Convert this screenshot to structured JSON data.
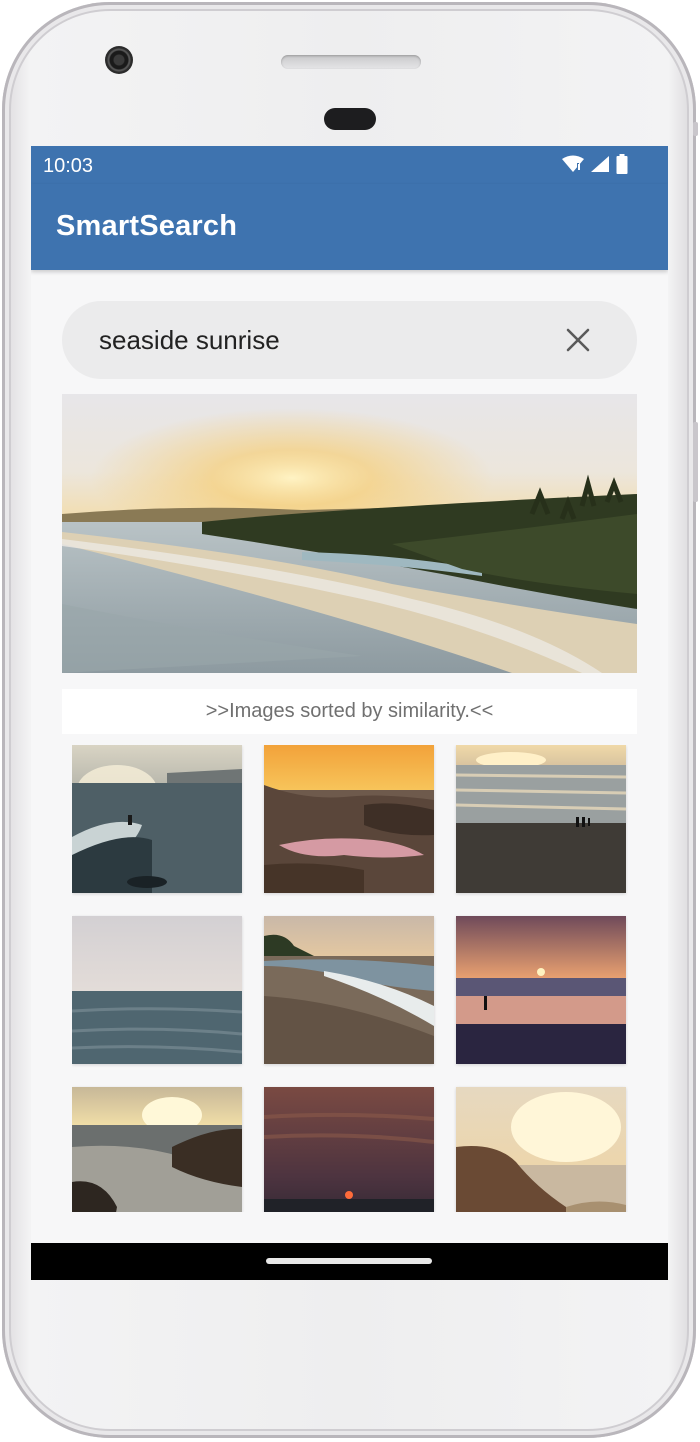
{
  "status_bar": {
    "time": "10:03",
    "icons": [
      "wifi-icon",
      "cell-signal-icon",
      "battery-icon"
    ]
  },
  "app": {
    "title": "SmartSearch",
    "accent_color": "#3e73af"
  },
  "search": {
    "value": "seaside sunrise",
    "clear_icon": "close-icon"
  },
  "results": {
    "caption": ">>Images sorted by similarity.<<",
    "count": 9
  }
}
